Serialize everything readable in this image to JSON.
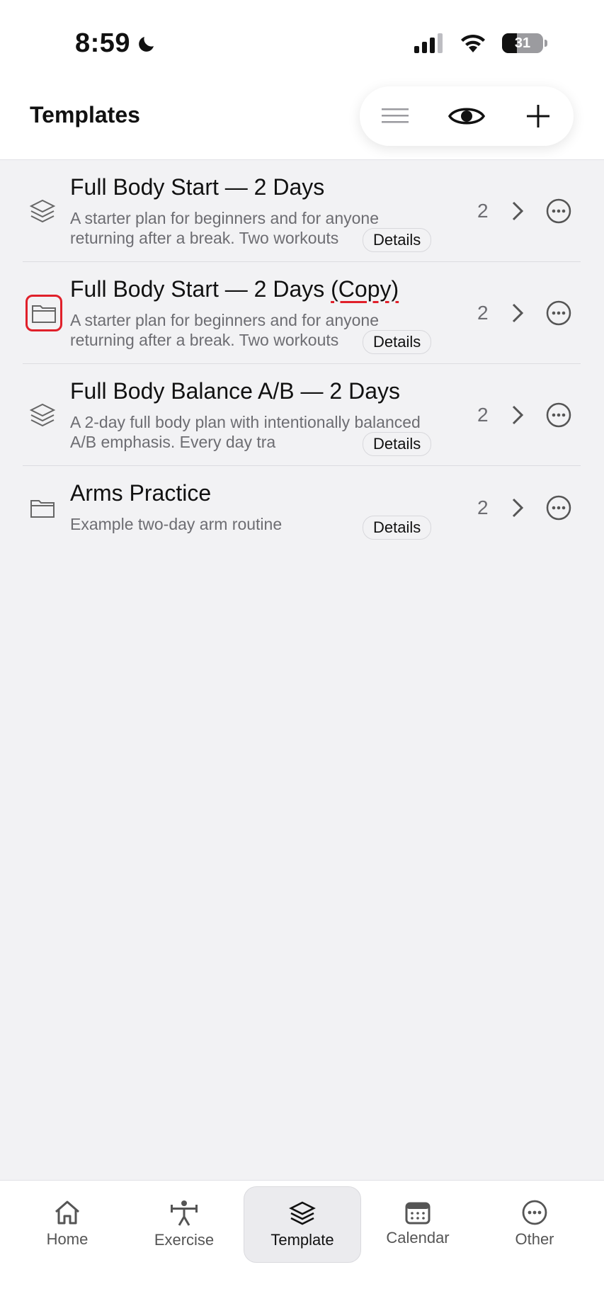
{
  "status": {
    "time": "8:59",
    "battery": "31"
  },
  "header": {
    "title": "Templates"
  },
  "toolbar": {
    "items": [
      "menu-icon",
      "eye-icon",
      "plus-icon"
    ]
  },
  "templates": [
    {
      "icon": "layers-icon",
      "title": "Full Body Start — 2 Days",
      "description": "A starter plan for beginners and for anyone returning after a break. Two workouts",
      "details_label": "Details",
      "count": "2"
    },
    {
      "icon": "folder-icon",
      "title_main": "Full Body Start — 2 Days ",
      "title_suffix": "(Copy)",
      "description": "A starter plan for beginners and for anyone returning after a break. Two workouts",
      "details_label": "Details",
      "count": "2",
      "selected": true
    },
    {
      "icon": "layers-icon",
      "title": "Full Body Balance A/B — 2 Days",
      "description": "A 2-day full body plan with intentionally balanced A/B emphasis. Every day tra",
      "details_label": "Details",
      "count": "2"
    },
    {
      "icon": "folder-icon",
      "title": "Arms Practice",
      "description": "Example two-day arm routine",
      "details_label": "Details",
      "count": "2"
    }
  ],
  "tabbar": {
    "tabs": [
      {
        "label": "Home",
        "icon": "home-icon"
      },
      {
        "label": "Exercise",
        "icon": "weightlifter-icon"
      },
      {
        "label": "Template",
        "icon": "layers-icon",
        "active": true
      },
      {
        "label": "Calendar",
        "icon": "calendar-icon"
      },
      {
        "label": "Other",
        "icon": "more-icon"
      }
    ]
  },
  "colors": {
    "accent_highlight": "#e0202a",
    "background": "#f2f2f4"
  }
}
